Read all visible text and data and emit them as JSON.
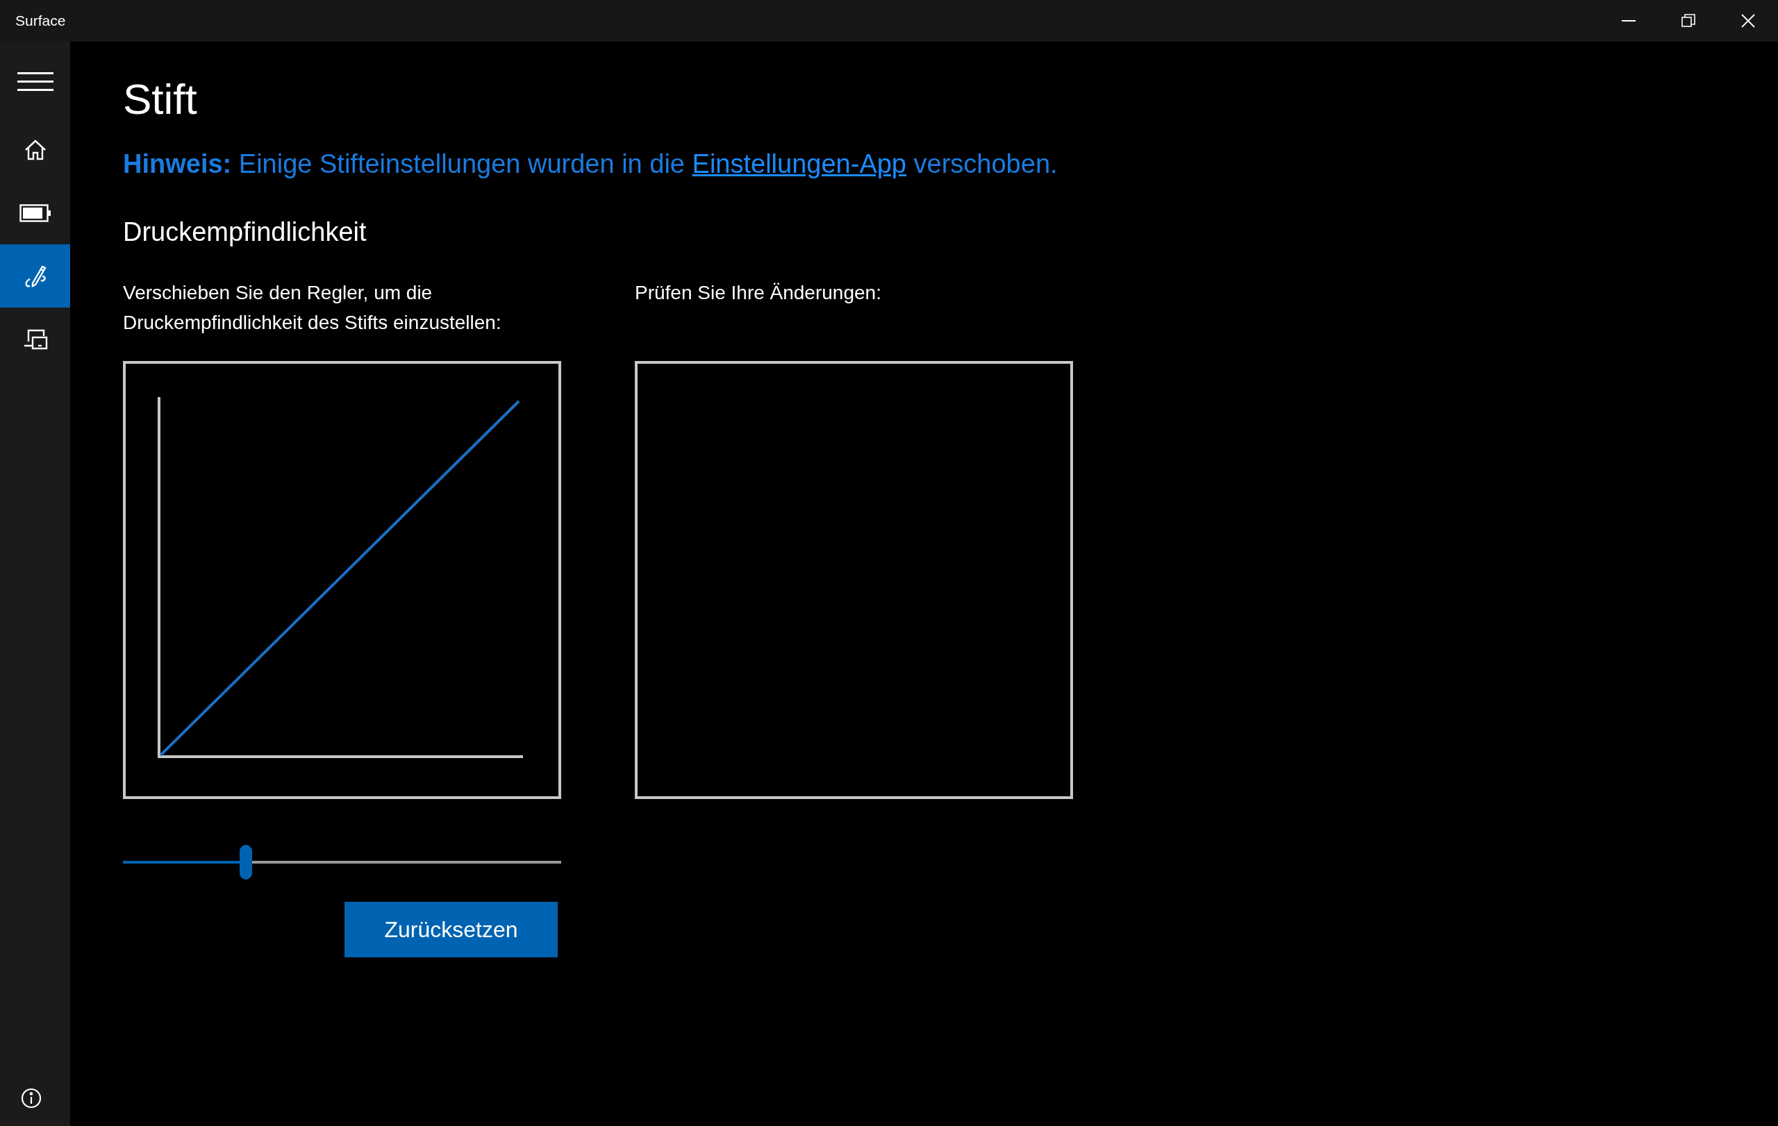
{
  "window": {
    "title": "Surface"
  },
  "sidebar": {
    "items": [
      {
        "kind": "home",
        "selected": false
      },
      {
        "kind": "battery",
        "selected": false
      },
      {
        "kind": "pen",
        "selected": true
      },
      {
        "kind": "devices",
        "selected": false
      }
    ]
  },
  "page": {
    "title": "Stift",
    "hint": {
      "before": "**Hinweis:** Einige Stifteinstellungen wurden in die ",
      "link": "Einstellungen-App",
      "after": " verschoben."
    },
    "section": "Druckempfindlichkeit",
    "slider_label": "Verschieben Sie den Regler, um die Druckempfindlichkeit des Stifts einzustellen:",
    "test_label": "Prüfen Sie Ihre Änderungen:",
    "slider": {
      "level": 0.28
    },
    "reset_button": "Zurücksetzen"
  }
}
